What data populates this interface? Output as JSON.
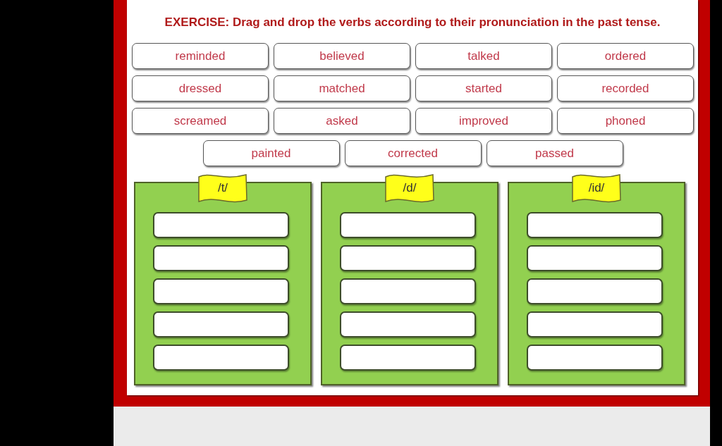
{
  "title": "EXERCISE: Drag and drop the verbs according to their pronunciation in the past tense.",
  "word_rows": [
    [
      "reminded",
      "believed",
      "talked",
      "ordered"
    ],
    [
      "dressed",
      "matched",
      "started",
      "recorded"
    ],
    [
      "screamed",
      "asked",
      "improved",
      "phoned"
    ],
    [
      "painted",
      "corrected",
      "passed"
    ]
  ],
  "categories": [
    {
      "label": "/t/",
      "answer_boxes": [
        {
          "filled": false
        },
        {
          "filled": false
        },
        {
          "filled": false
        },
        {
          "filled": false
        },
        {
          "filled": false
        }
      ]
    },
    {
      "label": "/d/",
      "answer_boxes": [
        {
          "filled": false
        },
        {
          "filled": false
        },
        {
          "filled": false
        },
        {
          "filled": false
        },
        {
          "filled": false
        }
      ]
    },
    {
      "label": "/id/",
      "answer_boxes": [
        {
          "filled": false
        },
        {
          "filled": false
        },
        {
          "filled": false
        },
        {
          "filled": false
        },
        {
          "filled": false
        }
      ]
    }
  ]
}
